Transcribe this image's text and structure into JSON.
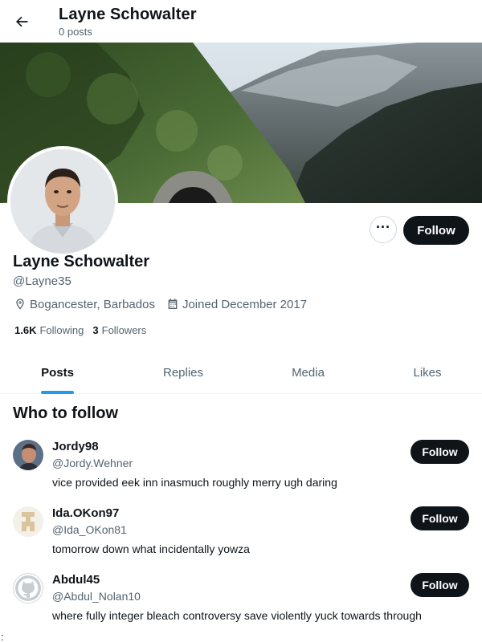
{
  "header": {
    "name": "Layne Schowalter",
    "posts": "0 posts"
  },
  "profile": {
    "name": "Layne Schowalter",
    "handle": "@Layne35",
    "location": "Bogancester, Barbados",
    "joined": "Joined December 2017",
    "following_count": "1.6K",
    "following_label": "Following",
    "followers_count": "3",
    "followers_label": "Followers",
    "follow_label": "Follow",
    "more_label": "···"
  },
  "tabs": [
    {
      "label": "Posts",
      "active": true
    },
    {
      "label": "Replies",
      "active": false
    },
    {
      "label": "Media",
      "active": false
    },
    {
      "label": "Likes",
      "active": false
    }
  ],
  "who_to_follow": {
    "title": "Who to follow",
    "suggestions": [
      {
        "name": "Jordy98",
        "handle": "@Jordy.Wehner",
        "bio": "vice provided eek inn inasmuch roughly merry ugh daring",
        "follow_label": "Follow"
      },
      {
        "name": "Ida.OKon97",
        "handle": "@Ida_OKon81",
        "bio": "tomorrow down what incidentally yowza",
        "follow_label": "Follow"
      },
      {
        "name": "Abdul45",
        "handle": "@Abdul_Nolan10",
        "bio": "where fully integer bleach controversy save violently yuck towards through",
        "follow_label": "Follow"
      }
    ]
  },
  "stray_char": ":",
  "colors": {
    "accent": "#1d9bf0",
    "button_dark": "#0f1419",
    "secondary_text": "#536471"
  },
  "icons": {
    "back": "arrow-left-icon",
    "location": "location-pin-icon",
    "calendar": "calendar-icon",
    "more": "more-horizontal-icon"
  }
}
